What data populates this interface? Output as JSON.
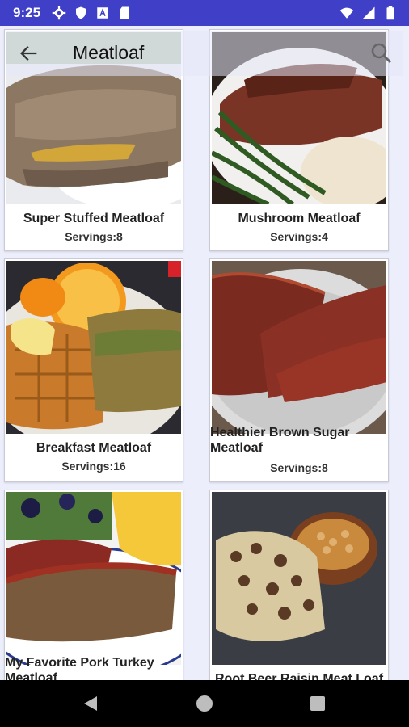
{
  "status_bar": {
    "time": "9:25",
    "left_icons": [
      "gear-icon",
      "shield-icon",
      "a-box-icon",
      "sd-card-icon"
    ],
    "right_icons": [
      "wifi-icon",
      "signal-icon",
      "battery-icon"
    ]
  },
  "toolbar": {
    "title": "Meatloaf",
    "back_icon": "arrow-left-icon",
    "search_icon": "search-icon"
  },
  "recipes": [
    {
      "title": "Super Stuffed Meatloaf",
      "servings": "Servings:8"
    },
    {
      "title": "Mushroom Meatloaf",
      "servings": "Servings:4"
    },
    {
      "title": "Breakfast Meatloaf",
      "servings": "Servings:16"
    },
    {
      "title": "Healthier Brown Sugar Meatloaf",
      "servings": "Servings:8"
    },
    {
      "title": "My Favorite Pork Turkey Meatloaf",
      "servings": ""
    },
    {
      "title": "Root Beer Raisin Meat Loaf",
      "servings": ""
    }
  ],
  "colors": {
    "status_bar": "#3f3fc8",
    "background": "#eceefb",
    "nav_bar": "#000000"
  }
}
